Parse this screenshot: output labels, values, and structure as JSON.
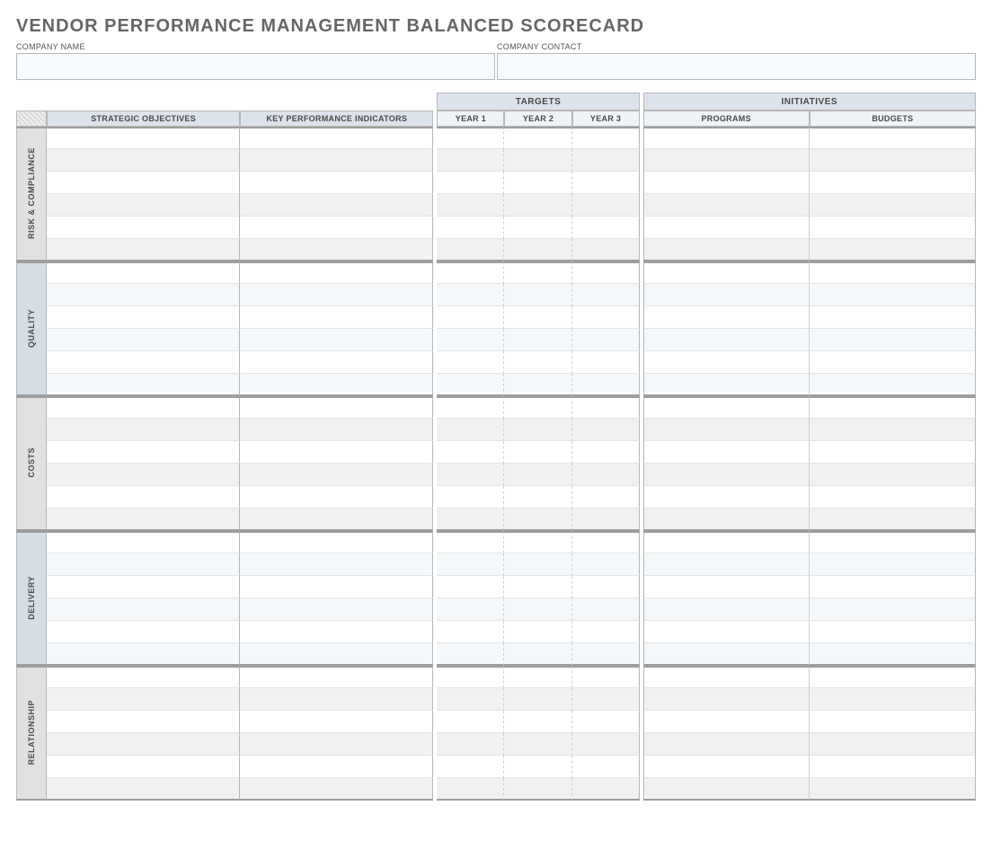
{
  "title": "VENDOR PERFORMANCE MANAGEMENT BALANCED SCORECARD",
  "company": {
    "name_label": "COMPANY NAME",
    "name_value": "",
    "contact_label": "COMPANY CONTACT",
    "contact_value": ""
  },
  "headers": {
    "targets": "TARGETS",
    "initiatives": "INITIATIVES",
    "strategic_objectives": "STRATEGIC OBJECTIVES",
    "kpi": "KEY PERFORMANCE INDICATORS",
    "year1": "YEAR 1",
    "year2": "YEAR 2",
    "year3": "YEAR 3",
    "programs": "PROGRAMS",
    "budgets": "BUDGETS"
  },
  "categories": [
    {
      "name": "RISK & COMPLIANCE",
      "tone": "grey",
      "rows": 6
    },
    {
      "name": "QUALITY",
      "tone": "blue",
      "rows": 6
    },
    {
      "name": "COSTS",
      "tone": "grey",
      "rows": 6
    },
    {
      "name": "DELIVERY",
      "tone": "blue",
      "rows": 6
    },
    {
      "name": "RELATIONSHIP",
      "tone": "grey",
      "rows": 6
    }
  ]
}
